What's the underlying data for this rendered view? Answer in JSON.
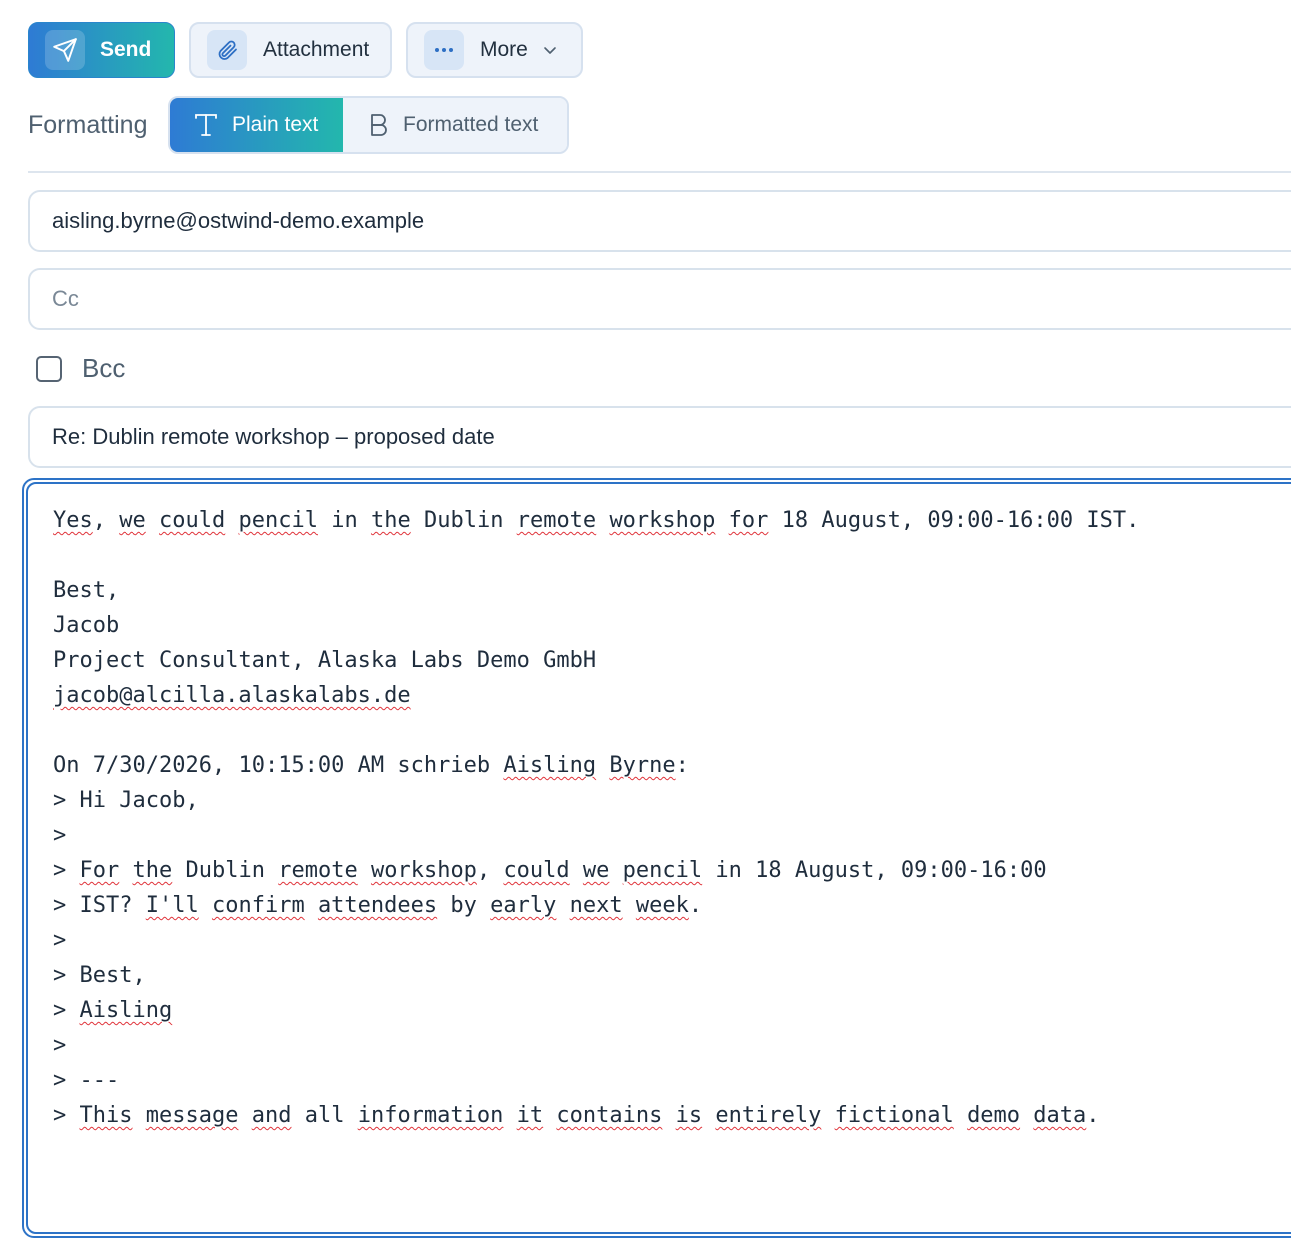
{
  "toolbar": {
    "send_label": "Send",
    "attachment_label": "Attachment",
    "more_label": "More"
  },
  "formatting": {
    "label": "Formatting",
    "plain_label": "Plain text",
    "formatted_label": "Formatted text",
    "selected": "Plain text"
  },
  "fields": {
    "to_value": "aisling.byrne@ostwind-demo.example",
    "cc_placeholder": "Cc",
    "bcc_label": "Bcc",
    "bcc_checked": false,
    "subject_value": "Re: Dublin remote workshop – proposed date"
  },
  "body": {
    "lines": [
      "Yes, we could pencil in the Dublin remote workshop for 18 August, 09:00-16:00 IST.",
      "",
      "Best,",
      "Jacob",
      "Project Consultant, Alaska Labs Demo GmbH",
      "jacob@alcilla.alaskalabs.de",
      "",
      "On 7/30/2026, 10:15:00 AM schrieb Aisling Byrne:",
      "> Hi Jacob,",
      ">",
      "> For the Dublin remote workshop, could we pencil in 18 August, 09:00-16:00",
      "> IST? I'll confirm attendees by early next week.",
      ">",
      "> Best,",
      "> Aisling",
      ">",
      "> ---",
      "> This message and all information it contains is entirely fictional demo data."
    ],
    "misspelled_words": [
      "Yes",
      "we",
      "could",
      "pencil",
      "the",
      "remote",
      "workshop",
      "for",
      "jacob@alcilla.alaskalabs.de",
      "Aisling",
      "Byrne",
      "For",
      "I'll",
      "confirm",
      "attendees",
      "early",
      "next",
      "week",
      "This",
      "message",
      "and",
      "information",
      "it",
      "contains",
      "is",
      "entirely",
      "fictional",
      "demo",
      "data"
    ]
  },
  "icons": {
    "send": "paper-plane-icon",
    "attachment": "paperclip-icon",
    "more": "ellipsis-icon",
    "dropdown": "chevron-down-icon",
    "plain": "text-t-icon",
    "formatted": "bold-b-icon"
  },
  "colors": {
    "accent_start": "#2e7bd4",
    "accent_end": "#23b7ad",
    "focus_border": "#2d73c7",
    "spell_underline": "#e0333a"
  }
}
